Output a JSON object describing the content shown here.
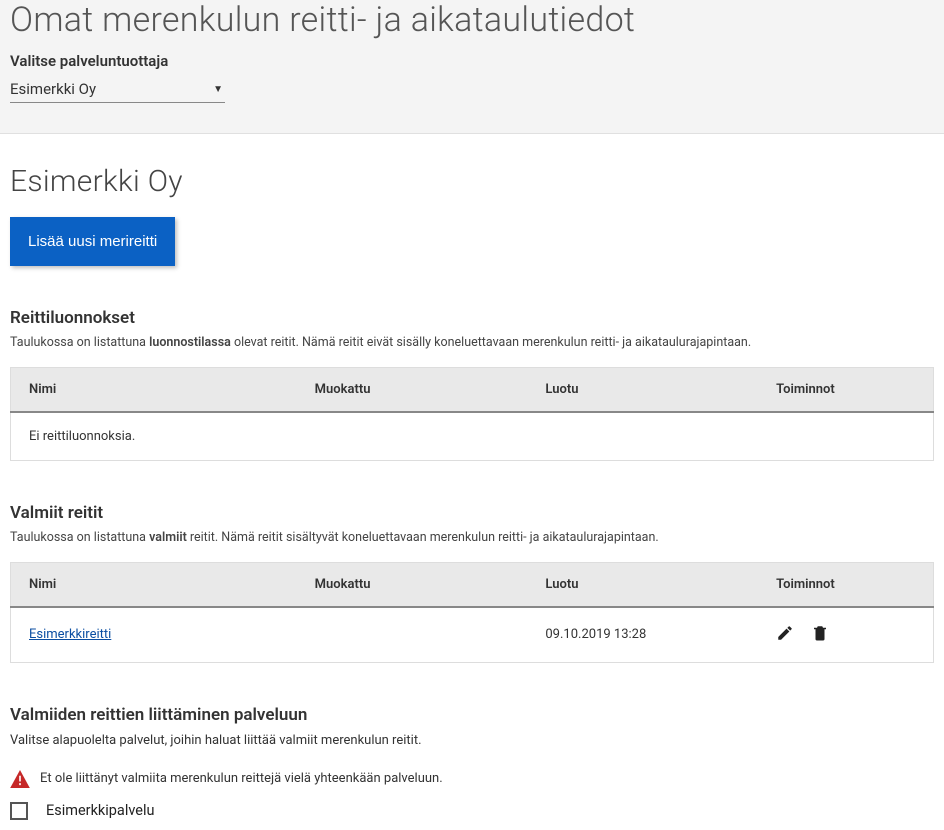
{
  "header": {
    "title": "Omat merenkulun reitti- ja aikataulutiedot",
    "provider_label": "Valitse palveluntuottaja",
    "provider_selected": "Esimerkki Oy"
  },
  "main": {
    "company_name": "Esimerkki Oy",
    "add_route_label": "Lisää uusi merireitti"
  },
  "drafts": {
    "heading": "Reittiluonnokset",
    "desc_pre": "Taulukossa on listattuna ",
    "desc_strong": "luonnostilassa",
    "desc_post": " olevat reitit. Nämä reitit eivät sisälly koneluettavaan merenkulun reitti- ja aikataulurajapintaan.",
    "columns": {
      "name": "Nimi",
      "modified": "Muokattu",
      "created": "Luotu",
      "actions": "Toiminnot"
    },
    "empty_text": "Ei reittiluonnoksia."
  },
  "ready": {
    "heading": "Valmiit reitit",
    "desc_pre": "Taulukossa on listattuna ",
    "desc_strong": "valmiit",
    "desc_post": " reitit. Nämä reitit sisältyvät koneluettavaan merenkulun reitti- ja aikataulurajapintaan.",
    "columns": {
      "name": "Nimi",
      "modified": "Muokattu",
      "created": "Luotu",
      "actions": "Toiminnot"
    },
    "rows": [
      {
        "name": "Esimerkkireitti",
        "modified": "",
        "created": "09.10.2019 13:28"
      }
    ]
  },
  "attach": {
    "heading": "Valmiiden reittien liittäminen palveluun",
    "desc": "Valitse alapuolelta palvelut, joihin haluat liittää valmiit merenkulun reitit.",
    "warning": "Et ole liittänyt valmiita merenkulun reittejä vielä yhteenkään palveluun.",
    "services": [
      {
        "label": "Esimerkkipalvelu",
        "checked": false
      }
    ]
  }
}
